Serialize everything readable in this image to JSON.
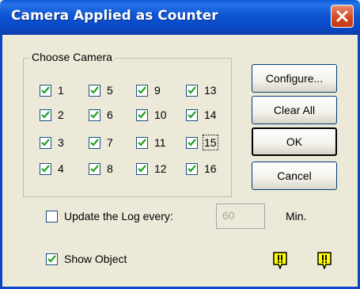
{
  "window": {
    "title": "Camera Applied as Counter",
    "close_icon": "close-icon"
  },
  "group": {
    "label": "Choose Camera",
    "cameras": [
      {
        "label": "1",
        "checked": true
      },
      {
        "label": "2",
        "checked": true
      },
      {
        "label": "3",
        "checked": true
      },
      {
        "label": "4",
        "checked": true
      },
      {
        "label": "5",
        "checked": true
      },
      {
        "label": "6",
        "checked": true
      },
      {
        "label": "7",
        "checked": true
      },
      {
        "label": "8",
        "checked": true
      },
      {
        "label": "9",
        "checked": true
      },
      {
        "label": "10",
        "checked": true
      },
      {
        "label": "11",
        "checked": true
      },
      {
        "label": "12",
        "checked": true
      },
      {
        "label": "13",
        "checked": true
      },
      {
        "label": "14",
        "checked": true
      },
      {
        "label": "15",
        "checked": true,
        "focused": true
      },
      {
        "label": "16",
        "checked": true
      }
    ]
  },
  "buttons": {
    "configure": "Configure...",
    "clear_all": "Clear All",
    "ok": "OK",
    "cancel": "Cancel"
  },
  "update_log": {
    "label": "Update the Log every:",
    "checked": false,
    "value": "60",
    "unit": "Min."
  },
  "show_object": {
    "label": "Show Object",
    "checked": true
  },
  "indicators": [
    "warning-icon",
    "warning-icon"
  ],
  "colors": {
    "titlebar": "#0a47c4",
    "close": "#d6491f",
    "background": "#ece9d8",
    "check": "#21a121",
    "warning": "#ffff00"
  }
}
